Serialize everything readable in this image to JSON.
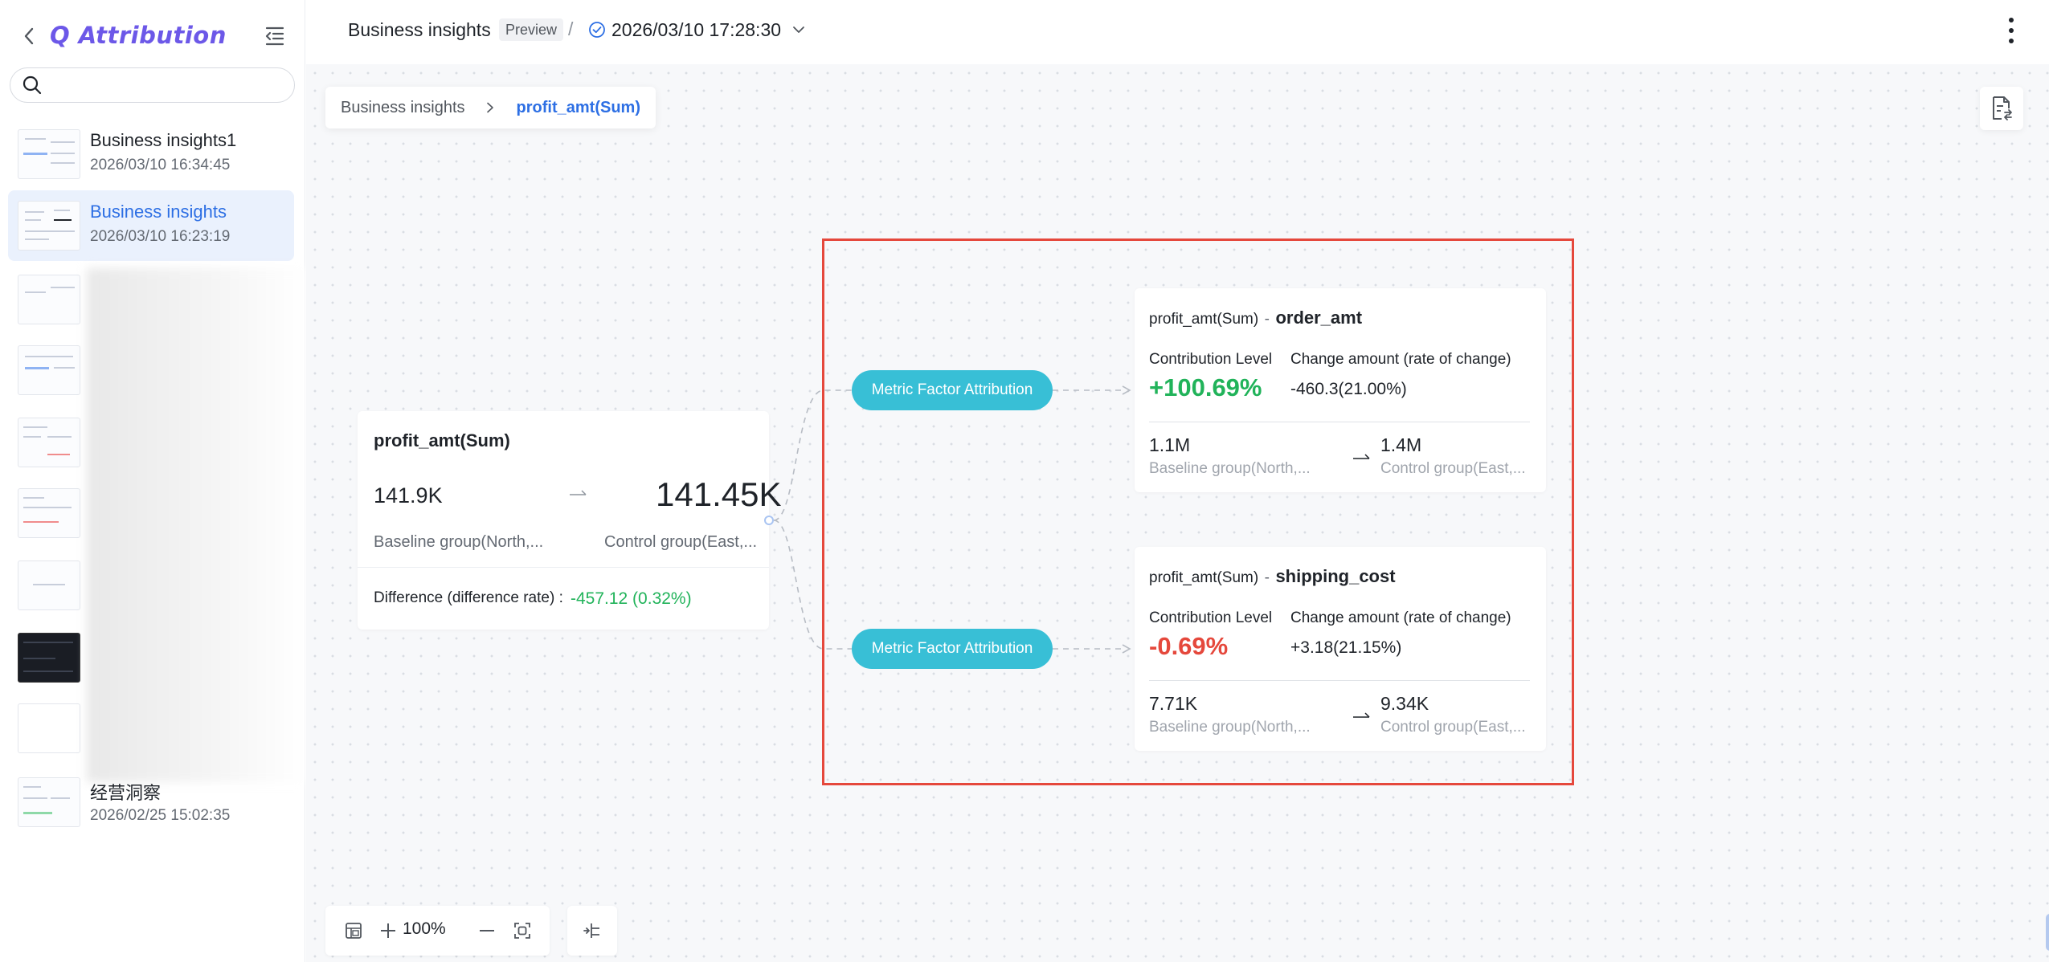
{
  "sidebar": {
    "app_name": "Q Attribution",
    "search_placeholder": "",
    "items": [
      {
        "title": "Business insights1",
        "date": "2026/03/10 16:34:45"
      },
      {
        "title": "Business insights",
        "date": "2026/03/10 16:23:19"
      },
      {
        "title": "经营洞察",
        "date": "2026/02/25 15:02:35"
      }
    ]
  },
  "header": {
    "title": "Business insights",
    "badge": "Preview",
    "separator": "/",
    "version": "2026/03/10 17:28:30"
  },
  "breadcrumb": {
    "root": "Business insights",
    "current": "profit_amt(Sum)"
  },
  "metric_card": {
    "title": "profit_amt(Sum)",
    "baseline_value": "141.9K",
    "control_value": "141.45K",
    "baseline_label": "Baseline group(North,...",
    "control_label": "Control group(East,...",
    "difference_label": "Difference (difference rate) :",
    "difference_value": "-457.12 (0.32%)"
  },
  "factor_nodes": [
    {
      "pill": "Metric Factor Attribution",
      "metric": "profit_amt(Sum)",
      "dash": "-",
      "factor": "order_amt",
      "contribution_label": "Contribution Level",
      "change_label": "Change amount (rate of change)",
      "contribution_value": "+100.69%",
      "change_value": "-460.3(21.00%)",
      "baseline_value": "1.1M",
      "baseline_label": "Baseline group(North,...",
      "control_value": "1.4M",
      "control_label": "Control group(East,..."
    },
    {
      "pill": "Metric Factor Attribution",
      "metric": "profit_amt(Sum)",
      "dash": "-",
      "factor": "shipping_cost",
      "contribution_label": "Contribution Level",
      "change_label": "Change amount (rate of change)",
      "contribution_value": "-0.69%",
      "change_value": "+3.18(21.15%)",
      "baseline_value": "7.71K",
      "baseline_label": "Baseline group(North,...",
      "control_value": "9.34K",
      "control_label": "Control group(East,..."
    }
  ],
  "zoom": {
    "level": "100%"
  },
  "colors": {
    "brand": "#6c58e8",
    "accent": "#2d6fe4",
    "pill": "#38bfd6",
    "positive": "#21b35a",
    "negative": "#e5483c",
    "highlight_border": "#e5483c"
  },
  "icons": [
    "back-icon",
    "collapse-menu-icon",
    "search-icon",
    "check-circle-icon",
    "chevron-down-icon",
    "more-vertical-icon",
    "chevron-right-icon",
    "report-icon",
    "arrow-right-icon",
    "minimap-icon",
    "zoom-in-icon",
    "zoom-out-icon",
    "fit-view-icon",
    "layout-icon"
  ]
}
